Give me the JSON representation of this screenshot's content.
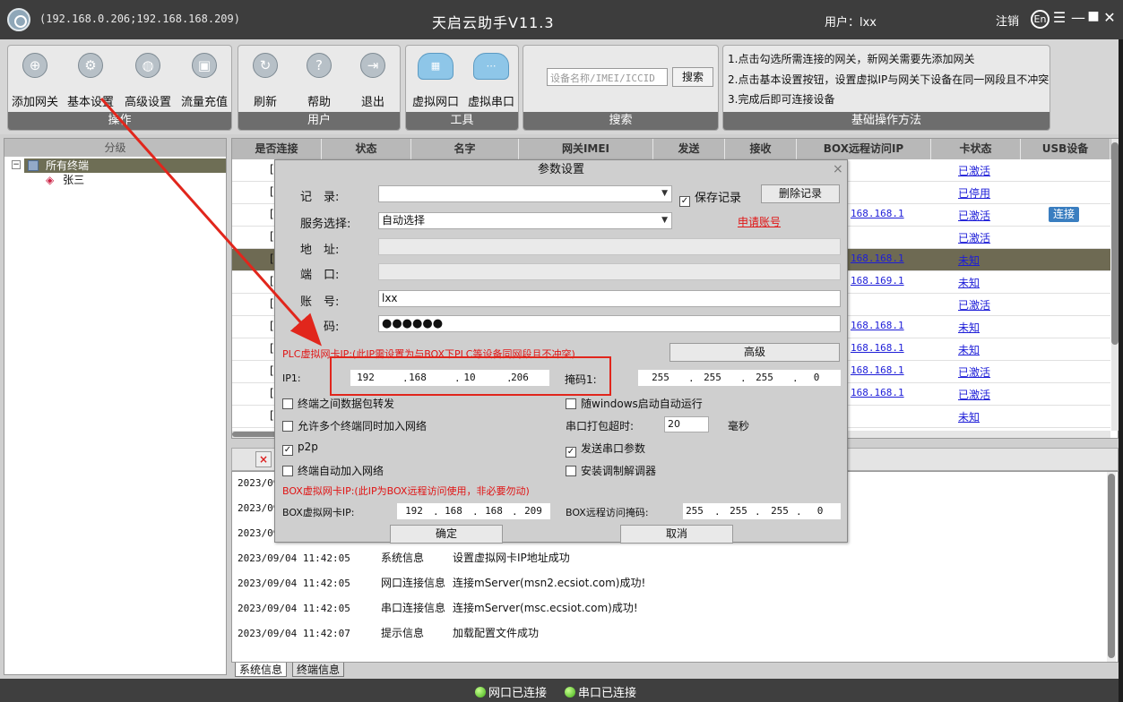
{
  "titlebar": {
    "ips": "(192.168.0.206;192.168.168.209)",
    "title": "天启云助手V11.3",
    "user": "用户：lxx",
    "logout": "注销",
    "lang": "En",
    "menu_icon": "☰",
    "min_icon": "—",
    "max_icon": "■",
    "close_icon": "✕"
  },
  "toolbar": {
    "ops": {
      "footer": "操作",
      "add_gateway": "添加网关",
      "basic_settings": "基本设置",
      "advanced_settings": "高级设置",
      "traffic_recharge": "流量充值"
    },
    "user": {
      "footer": "用户",
      "refresh": "刷新",
      "help": "帮助",
      "exit": "退出"
    },
    "tools": {
      "footer": "工具",
      "virtual_net": "虚拟网口",
      "virtual_serial": "虚拟串口"
    },
    "search": {
      "footer": "搜索",
      "placeholder": "设备名称/IMEI/ICCID",
      "button": "搜索"
    },
    "help": {
      "footer": "基础操作方法",
      "line1": "1.点击勾选所需连接的网关，新网关需要先添加网关",
      "line2": "2.点击基本设置按钮，设置虚拟IP与网关下设备在同一网段且不冲突",
      "line3": "3.完成后即可连接设备"
    }
  },
  "tree": {
    "header": "分级",
    "expand": "−",
    "all": "所有终端",
    "child": "张三"
  },
  "grid": {
    "headers": [
      "是否连接",
      "状态",
      "名字",
      "网关IMEI",
      "发送",
      "接收",
      "BOX远程访问IP",
      "卡状态",
      "USB设备"
    ],
    "rows": [
      {
        "chk": "[",
        "ip": "",
        "card": "已激活",
        "usb": ""
      },
      {
        "chk": "[",
        "ip": "",
        "card": "已停用",
        "usb": ""
      },
      {
        "chk": "[",
        "ip": "168.168.1",
        "card": "已激活",
        "usb": "连接"
      },
      {
        "chk": "[",
        "ip": "",
        "card": "已激活",
        "usb": ""
      },
      {
        "chk": "[",
        "ip": "168.168.1",
        "card": "未知",
        "usb": ""
      },
      {
        "chk": "[",
        "ip": "168.169.1",
        "card": "未知",
        "usb": ""
      },
      {
        "chk": "[",
        "ip": "",
        "card": "已激活",
        "usb": ""
      },
      {
        "chk": "[",
        "ip": "168.168.1",
        "card": "未知",
        "usb": ""
      },
      {
        "chk": "[",
        "ip": "168.168.1",
        "card": "未知",
        "usb": ""
      },
      {
        "chk": "[",
        "ip": "168.168.1",
        "card": "已激活",
        "usb": ""
      },
      {
        "chk": "[",
        "ip": "168.168.1",
        "card": "已激活",
        "usb": ""
      },
      {
        "chk": "[",
        "ip": "",
        "card": "未知",
        "usb": ""
      }
    ]
  },
  "log": {
    "delete_icon": "×",
    "rows": [
      {
        "time": "2023/09",
        "type": "",
        "msg": ""
      },
      {
        "time": "2023/09",
        "type": "",
        "msg": ""
      },
      {
        "time": "2023/09",
        "type": "",
        "msg": ""
      },
      {
        "time": "2023/09/04 11:42:05",
        "type": "系统信息",
        "msg": "设置虚拟网卡IP地址成功"
      },
      {
        "time": "2023/09/04 11:42:05",
        "type": "网口连接信息",
        "msg": "连接mServer(msn2.ecsiot.com)成功!"
      },
      {
        "time": "2023/09/04 11:42:05",
        "type": "串口连接信息",
        "msg": "连接mServer(msc.ecsiot.com)成功!"
      },
      {
        "time": "2023/09/04 11:42:07",
        "type": "提示信息",
        "msg": "加载配置文件成功"
      }
    ],
    "tab_system": "系统信息",
    "tab_terminal": "终端信息"
  },
  "statusbar": {
    "net": "网口已连接",
    "serial": "串口已连接"
  },
  "dialog": {
    "title": "参数设置",
    "close": "×",
    "record_label": "记　录:",
    "record_value": "",
    "save_record": "保存记录",
    "save_record_checked": true,
    "delete_record": "删除记录",
    "service_label": "服务选择:",
    "service_value": "自动选择",
    "apply_account": "申请账号",
    "address_label": "地　址:",
    "port_label": "端　口:",
    "account_label": "账　号:",
    "account_value": "lxx",
    "password_label": "密　码:",
    "password_value": "●●●●●●",
    "plc_note": "PLC虚拟网卡IP:(此IP需设置为与BOX下PLC等设备同网段且不冲突)",
    "advanced": "高级",
    "ip1_label": "IP1:",
    "ip1": [
      "192",
      "168",
      "10",
      "206"
    ],
    "mask1_label": "掩码1:",
    "mask1": [
      "255",
      "255",
      "255",
      "0"
    ],
    "opt_forward": "终端之间数据包转发",
    "opt_forward_checked": false,
    "opt_autostart": "随windows启动自动运行",
    "opt_autostart_checked": false,
    "opt_multi": "允许多个终端同时加入网络",
    "opt_multi_checked": false,
    "serial_timeout_label": "串口打包超时:",
    "serial_timeout_value": "20",
    "serial_timeout_unit": "毫秒",
    "opt_p2p": "p2p",
    "opt_p2p_checked": true,
    "opt_send_serial": "发送串口参数",
    "opt_send_serial_checked": true,
    "opt_autojoin": "终端自动加入网络",
    "opt_autojoin_checked": false,
    "opt_modem": "安装调制解调器",
    "opt_modem_checked": false,
    "box_note": "BOX虚拟网卡IP:(此IP为BOX远程访问使用，非必要勿动)",
    "box_ip_label": "BOX虚拟网卡IP:",
    "box_ip": [
      "192",
      "168",
      "168",
      "209"
    ],
    "box_mask_label": "BOX远程访问掩码:",
    "box_mask": [
      "255",
      "255",
      "255",
      "0"
    ],
    "ok": "确定",
    "cancel": "取消"
  },
  "colors": {
    "titlebar": "#3d3d3d",
    "group_footer": "#6d6d6d",
    "selected_row": "#6e6a53",
    "link": "#1d1dd8",
    "annotation_red": "#e1261c",
    "status_dot": "#3fae14"
  }
}
